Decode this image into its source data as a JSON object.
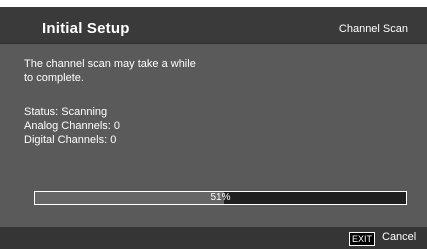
{
  "header": {
    "title": "Initial Setup",
    "subtitle": "Channel Scan"
  },
  "message": {
    "line1": "The channel scan may take a while",
    "line2": "to complete."
  },
  "status": {
    "status_text": "Status: Scanning",
    "analog_text": "Analog Channels: 0",
    "digital_text": "Digital Channels: 0"
  },
  "progress": {
    "percent": 51,
    "label": "51%"
  },
  "footer": {
    "exit_key": "EXIT",
    "cancel_label": "Cancel"
  },
  "colors": {
    "background": "#5a5a5a",
    "header": "#3a3a3a",
    "progress_fill": "#666666",
    "progress_track": "#1f1f1f",
    "text": "#ffffff"
  }
}
